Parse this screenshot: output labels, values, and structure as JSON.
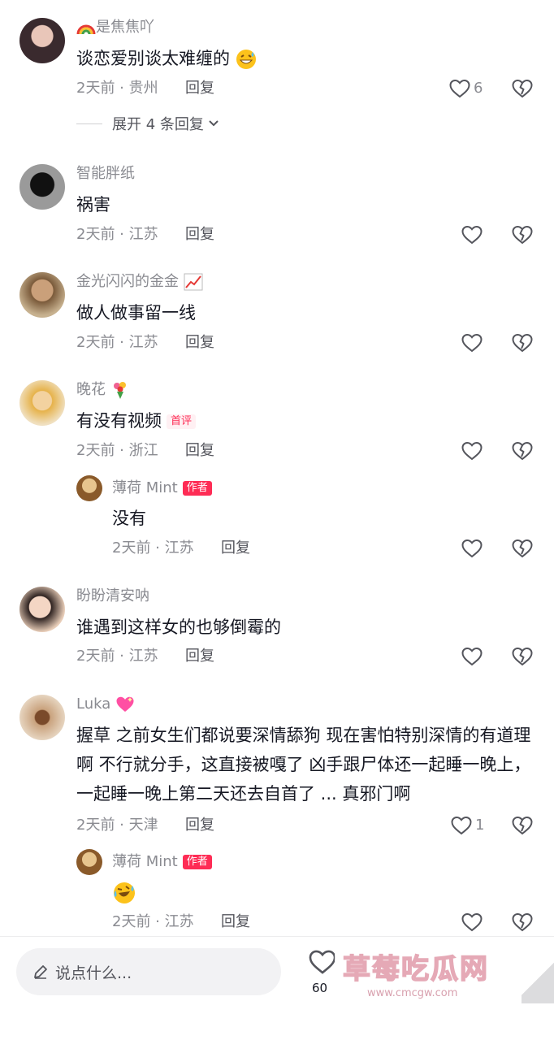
{
  "colors": {
    "accent": "#fe2c55",
    "muted": "#8a8b91",
    "text": "#161823"
  },
  "comments": [
    {
      "name": "是焦焦吖",
      "name_emoji": "rainbow-emoji",
      "text": "谈恋爱别谈太难缠的",
      "text_emoji": "grin-sweat-emoji",
      "meta": "2天前 · 贵州",
      "reply": "回复",
      "likes": "6"
    },
    {
      "name": "智能胖纸",
      "text": "祸害",
      "meta": "2天前 · 江苏",
      "reply": "回复",
      "likes": ""
    },
    {
      "name": "金光闪闪的金金",
      "name_emoji": "chart-up-emoji",
      "text": "做人做事留一线",
      "meta": "2天前 · 江苏",
      "reply": "回复",
      "likes": ""
    },
    {
      "name": "晚花",
      "name_emoji": "bouquet-emoji",
      "text": "有没有视频",
      "badge": "首评",
      "meta": "2天前 · 浙江",
      "reply": "回复",
      "likes": "",
      "sub": {
        "name": "薄荷 Mint",
        "badge": "作者",
        "text": "没有",
        "meta": "2天前 · 江苏",
        "reply": "回复"
      }
    },
    {
      "name": "盼盼清安呐",
      "text": "谁遇到这样女的也够倒霉的",
      "meta": "2天前 · 江苏",
      "reply": "回复",
      "likes": ""
    },
    {
      "name": "Luka",
      "name_emoji": "sparkling-heart-emoji",
      "text": "握草 之前女生们都说要深情舔狗 现在害怕特别深情的有道理啊  不行就分手，这直接被嘎了 凶手跟尸体还一起睡一晚上，一起睡一晚上第二天还去自首了 ... 真邪门啊",
      "meta": "2天前 · 天津",
      "reply": "回复",
      "likes": "1",
      "sub": {
        "name": "薄荷 Mint",
        "badge": "作者",
        "text": "",
        "text_emoji": "crying-laughing-emoji",
        "meta": "2天前 · 江苏",
        "reply": "回复"
      }
    }
  ],
  "expand_replies": "展开 4 条回复",
  "bottom": {
    "placeholder": "说点什么...",
    "like_count": "60"
  },
  "watermark": {
    "title": "草莓吃瓜网",
    "url": "www.cmcgw.com"
  }
}
